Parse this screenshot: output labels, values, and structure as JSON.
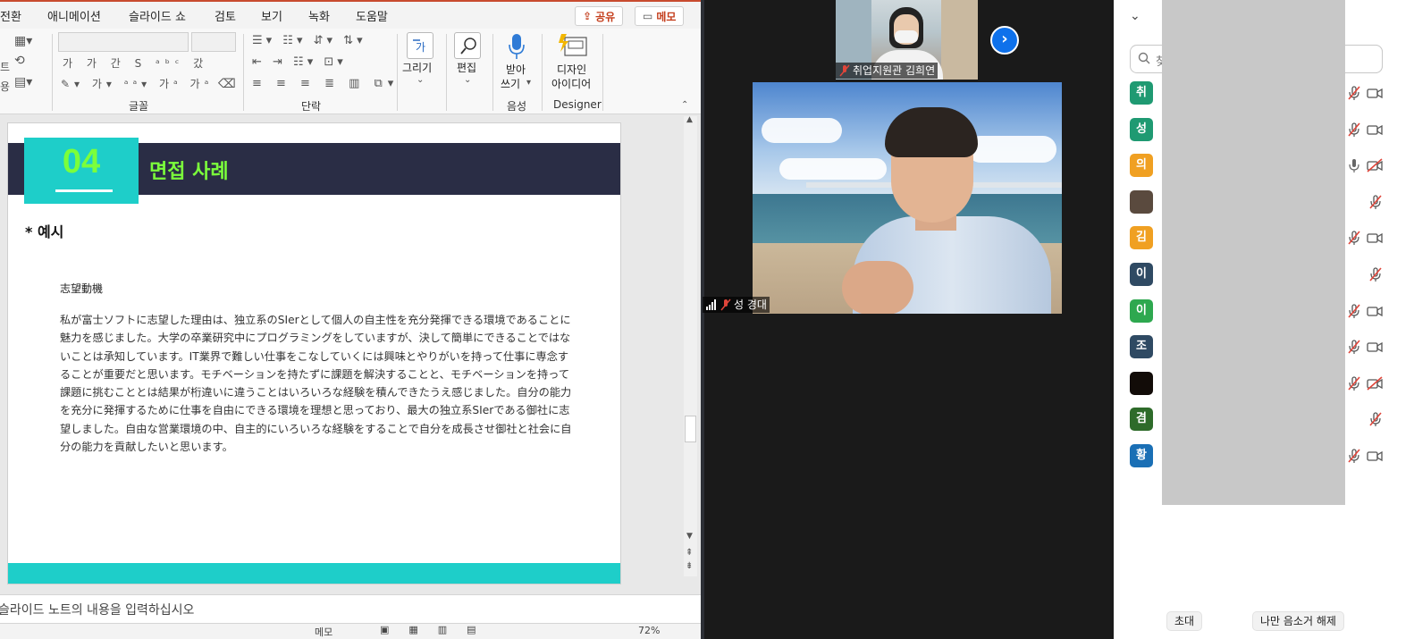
{
  "ppt": {
    "tabs": [
      "전환",
      "애니메이션",
      "슬라이드 쇼",
      "검토",
      "보기",
      "녹화",
      "도움말"
    ],
    "share_label": "공유",
    "comment_label": "메모",
    "ribbon": {
      "font_group_label": "글꼴",
      "paragraph_group_label": "단락",
      "draw_label": "그리기",
      "edit_label": "편집",
      "dictate_label_1": "받아",
      "dictate_label_2": "쓰기",
      "voice_group_label": "음성",
      "designer_label_1": "디자인",
      "designer_label_2": "아이디어",
      "designer_group_label": "Designer",
      "left_labels": [
        "트",
        "용"
      ]
    },
    "slide": {
      "number": "04",
      "title": "면접 사례",
      "subtitle": "* 예시",
      "heading": "志望動機",
      "body": "私が富士ソフトに志望した理由は、独立系のSIerとして個人の自主性を充分発揮できる環境であることに魅力を感じました。大学の卒業研究中にプログラミングをしていますが、決して簡単にできることではないことは承知しています。IT業界で難しい仕事をこなしていくには興味とやりがいを持って仕事に専念することが重要だと思います。モチベーションを持たずに課題を解決することと、モチベーションを持って課題に挑むこととは結果が桁違いに違うことはいろいろな経験を積んできたうえ感じました。自分の能力を充分に発揮するために仕事を自由にできる環境を理想と思っており、最大の独立系SIerである御社に志望しました。自由な営業環境の中、自主的にいろいろな経験をすることで自分を成長させ御社と社会に自分の能力を貢献したいと思います。"
    },
    "notes_placeholder": "슬라이드 노트의 내용을 입력하십시오",
    "status": {
      "memo_label": "메모",
      "zoom": "72%"
    }
  },
  "zoom": {
    "top_video_name": "취업지원관 김희연",
    "main_video_name": "성 경대",
    "next_arrow": "›"
  },
  "panel": {
    "search_placeholder": "찾",
    "participants": [
      {
        "initial": "취",
        "color": "#1f9a72",
        "mic": "muted",
        "cam": "on"
      },
      {
        "initial": "성",
        "color": "#1f9a72",
        "mic": "muted",
        "cam": "on"
      },
      {
        "initial": "의",
        "color": "#f0a022",
        "mic": "on",
        "cam": "off"
      },
      {
        "initial": "",
        "color": "#5a4a3e",
        "mic": "muted",
        "cam": "none"
      },
      {
        "initial": "김",
        "color": "#f0a022",
        "mic": "muted",
        "cam": "on"
      },
      {
        "initial": "이",
        "color": "#2f4a63",
        "mic": "muted",
        "cam": "none"
      },
      {
        "initial": "이",
        "color": "#2ea84f",
        "mic": "muted",
        "cam": "on"
      },
      {
        "initial": "조",
        "color": "#2f4a63",
        "mic": "muted",
        "cam": "on"
      },
      {
        "initial": "",
        "color": "#120c08",
        "mic": "muted",
        "cam": "off"
      },
      {
        "initial": "겸",
        "color": "#2e6b2a",
        "mic": "muted",
        "cam": "none"
      },
      {
        "initial": "황",
        "color": "#1a6fb5",
        "mic": "muted",
        "cam": "on"
      }
    ],
    "invite_label": "초대",
    "unmute_label": "나만 음소거 해제"
  }
}
